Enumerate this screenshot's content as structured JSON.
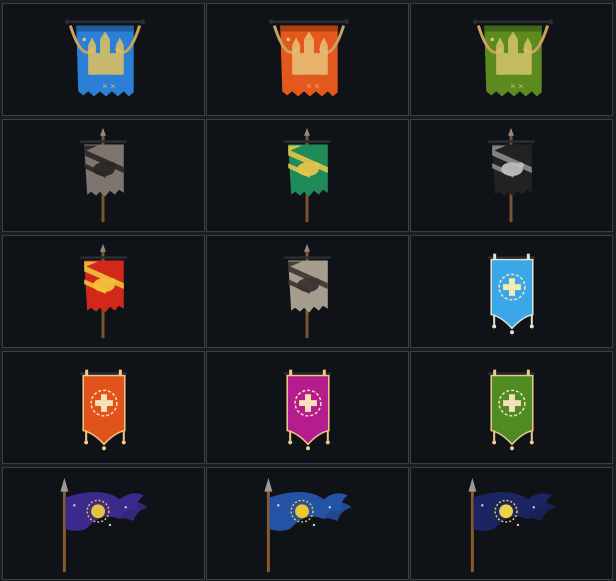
{
  "banners": [
    {
      "id": "castle-blue",
      "kind": "castle",
      "main": "#2b7fd6",
      "trim": "#1f5ea3",
      "emblem": "#e2c35e",
      "icon": "castle-icon"
    },
    {
      "id": "castle-orange",
      "kind": "castle",
      "main": "#e2581d",
      "trim": "#b33f10",
      "emblem": "#e9c27a",
      "icon": "castle-icon"
    },
    {
      "id": "castle-green",
      "kind": "castle",
      "main": "#5d8a1f",
      "trim": "#416615",
      "emblem": "#d6c46a",
      "icon": "castle-icon"
    },
    {
      "id": "wolf-grey",
      "kind": "pole",
      "main": "#7d7570",
      "stripe": "#2a2624",
      "emblem": "#2a2624",
      "icon": "wolf-icon"
    },
    {
      "id": "fish-green",
      "kind": "pole",
      "main": "#1f8a5a",
      "stripe": "#e3c54a",
      "emblem": "#e3c54a",
      "icon": "fish-icon"
    },
    {
      "id": "dragon-black",
      "kind": "pole",
      "main": "#222222",
      "stripe": "#8d8d8d",
      "emblem": "#bdbdbd",
      "icon": "dragon-icon"
    },
    {
      "id": "serpent-red",
      "kind": "pole",
      "main": "#d2271b",
      "stripe": "#f0c23a",
      "emblem": "#f0c23a",
      "icon": "serpent-icon"
    },
    {
      "id": "raven-stone",
      "kind": "pole",
      "main": "#a79d8e",
      "stripe": "#3a3531",
      "emblem": "#3a3531",
      "icon": "raven-icon"
    },
    {
      "id": "crown-skyblue",
      "kind": "pennant",
      "main": "#3aa8e8",
      "trim": "#e8e2cc",
      "emblem": "#f4e9b8",
      "icon": "crown-icon"
    },
    {
      "id": "fleur-orange",
      "kind": "pennant",
      "main": "#e0541c",
      "trim": "#f2c98a",
      "emblem": "#f6e2b8",
      "icon": "fleur-de-lis-icon"
    },
    {
      "id": "cross-magenta",
      "kind": "pennant",
      "main": "#b51d8f",
      "trim": "#f2c98a",
      "emblem": "#f6e2b8",
      "icon": "cross-icon"
    },
    {
      "id": "trident-green",
      "kind": "pennant",
      "main": "#4e8b23",
      "trim": "#f2c98a",
      "emblem": "#f6e2b8",
      "icon": "trident-icon"
    },
    {
      "id": "star-purple",
      "kind": "spear",
      "main": "#3b2a8c",
      "emblem": "#e6c43a",
      "icon": "star-icon"
    },
    {
      "id": "sun-blue",
      "kind": "spear",
      "main": "#2453a6",
      "emblem": "#f0c72c",
      "icon": "sun-icon"
    },
    {
      "id": "moon-navy",
      "kind": "spear",
      "main": "#1a2561",
      "emblem": "#f0d24a",
      "icon": "moon-icon"
    }
  ]
}
